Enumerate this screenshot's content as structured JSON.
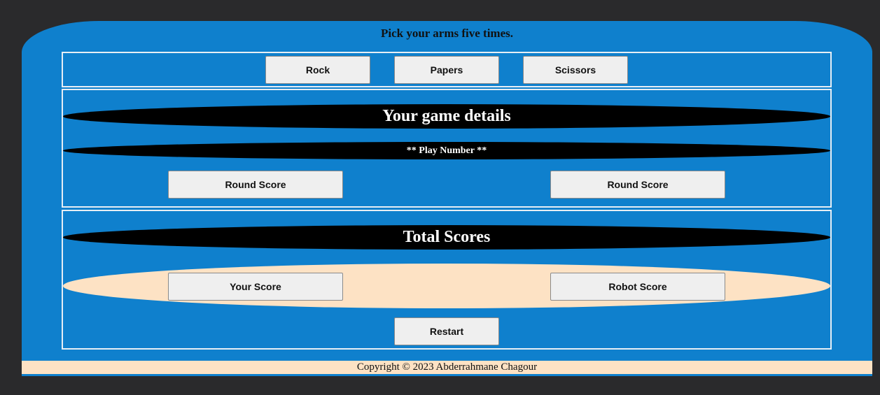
{
  "header": {
    "instruction": "Pick your arms five times."
  },
  "arms": {
    "rock_label": "Rock",
    "paper_label": "Papers",
    "scissors_label": "Scissors"
  },
  "details": {
    "title": "Your game details",
    "play_number": "** Play Number **",
    "round_score_player": "Round Score",
    "round_score_robot": "Round Score"
  },
  "totals": {
    "title": "Total Scores",
    "your_score": "Your Score",
    "robot_score": "Robot Score",
    "restart_label": "Restart"
  },
  "footer": {
    "copyright": "Copyright © 2023 Abderrahmane Chagour"
  },
  "colors": {
    "background": "#2a2a2c",
    "panel": "#0f80cd",
    "band": "#000000",
    "accent": "#fde2c4",
    "button": "#efefef"
  }
}
